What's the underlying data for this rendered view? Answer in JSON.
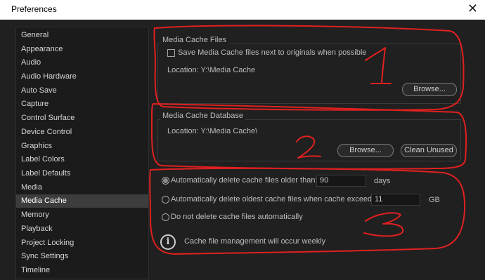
{
  "window": {
    "title": "Preferences",
    "close_glyph": "✕"
  },
  "sidebar": {
    "items": [
      {
        "label": "General"
      },
      {
        "label": "Appearance"
      },
      {
        "label": "Audio"
      },
      {
        "label": "Audio Hardware"
      },
      {
        "label": "Auto Save"
      },
      {
        "label": "Capture"
      },
      {
        "label": "Control Surface"
      },
      {
        "label": "Device Control"
      },
      {
        "label": "Graphics"
      },
      {
        "label": "Label Colors"
      },
      {
        "label": "Label Defaults"
      },
      {
        "label": "Media"
      },
      {
        "label": "Media Cache"
      },
      {
        "label": "Memory"
      },
      {
        "label": "Playback"
      },
      {
        "label": "Project Locking"
      },
      {
        "label": "Sync Settings"
      },
      {
        "label": "Timeline"
      }
    ],
    "selected": "Media Cache"
  },
  "media_cache_files": {
    "heading": "Media Cache Files",
    "checkbox_label": "Save Media Cache files next to originals when possible",
    "checkbox_checked": false,
    "location": "Location:  Y:\\Media Cache",
    "browse_label": "Browse..."
  },
  "media_cache_database": {
    "heading": "Media Cache Database",
    "location": "Location:  Y:\\Media Cache\\",
    "browse_label": "Browse...",
    "clean_label": "Clean Unused"
  },
  "cache_management": {
    "option_older": {
      "label": "Automatically delete cache files older than:",
      "value": "90",
      "unit": "days",
      "selected": true
    },
    "option_exceeds": {
      "label": "Automatically delete oldest cache files when cache exceeds:",
      "value": "11",
      "unit": "GB",
      "selected": false
    },
    "option_none": {
      "label": "Do not delete cache files automatically",
      "selected": false
    },
    "info_glyph": "i",
    "info_text": "Cache file management will occur weekly"
  },
  "annotations": {
    "color": "#e02020",
    "numbers": [
      "1",
      "2",
      "3"
    ]
  },
  "colors": {
    "background": "#202020",
    "sidebar_selected": "#3d3d3d",
    "text": "#bdbdbd"
  }
}
